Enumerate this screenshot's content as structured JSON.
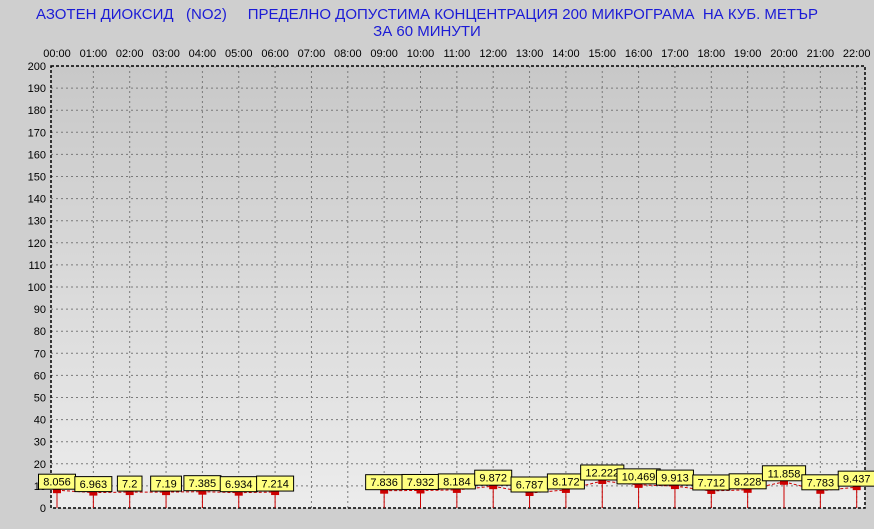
{
  "chart_data": {
    "type": "line",
    "title": "АЗОТЕН ДИОКСИД   (NO2)     ПРЕДЕЛНО ДОПУСТИМА КОНЦЕНТРАЦИЯ 200 МИКРОГРАМА  НА КУБ. МЕТЪР",
    "subtitle": "ЗА 60 МИНУТИ",
    "xlabel": "",
    "ylabel": "",
    "categories": [
      "00:00",
      "01:00",
      "02:00",
      "03:00",
      "04:00",
      "05:00",
      "06:00",
      "07:00",
      "08:00",
      "09:00",
      "10:00",
      "11:00",
      "12:00",
      "13:00",
      "14:00",
      "15:00",
      "16:00",
      "17:00",
      "18:00",
      "19:00",
      "20:00",
      "21:00",
      "22:00"
    ],
    "y_ticks": [
      "0",
      "10",
      "20",
      "30",
      "40",
      "50",
      "60",
      "70",
      "80",
      "90",
      "100",
      "110",
      "120",
      "130",
      "140",
      "150",
      "160",
      "170",
      "180",
      "190",
      "200"
    ],
    "ylim": [
      0,
      200
    ],
    "grid": true,
    "series": [
      {
        "values": [
          8.056,
          6.963,
          7.2,
          7.19,
          7.385,
          6.934,
          7.214,
          null,
          null,
          7.836,
          7.932,
          8.184,
          9.872,
          6.787,
          8.172,
          12.222,
          10.469,
          9.913,
          7.712,
          8.228,
          11.858,
          7.783,
          9.437
        ],
        "labels": [
          "8.056",
          "6.963",
          "7.2",
          "7.19",
          "7.385",
          "6.934",
          "7.214",
          "",
          "",
          "7.836",
          "7.932",
          "8.184",
          "9.872",
          "6.787",
          "8.172",
          "12.222",
          "10.469",
          "9.913",
          "7.712",
          "8.228",
          "11.858",
          "7.783",
          "9.437"
        ]
      }
    ],
    "colors": {
      "plot_bg": "#d6d6d6",
      "title": "#1b1bd6",
      "line": "#cc0000",
      "marker": "#cc0000",
      "label_bg": "#ffff80",
      "grid": "#7a7a7a"
    }
  }
}
